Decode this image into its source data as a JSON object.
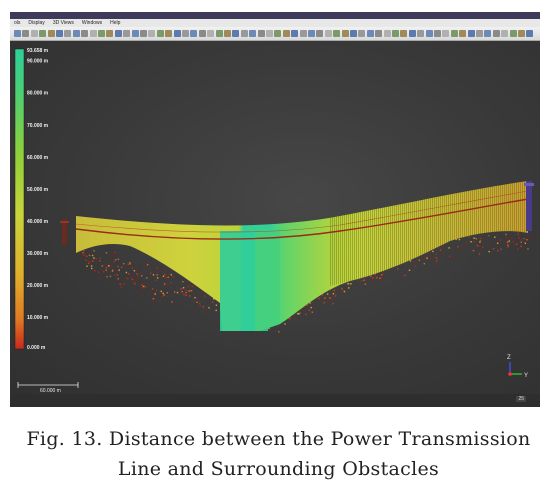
{
  "menubar": {
    "items": [
      "ols",
      "Display",
      "3D Views",
      "Windows",
      "Help"
    ]
  },
  "colorbar": {
    "labels": [
      "93.658 m",
      "90.000 m",
      "80.000 m",
      "70.000 m",
      "60.000 m",
      "50.000 m",
      "40.000 m",
      "30.000 m",
      "20.000 m",
      "10.000 m",
      "0.000 m"
    ],
    "values": [
      93.658,
      90,
      80,
      70,
      60,
      50,
      40,
      30,
      20,
      10,
      0
    ],
    "colors": {
      "top": "#2ecf9a",
      "mid": "#c6d63a",
      "low": "#e39a2a",
      "bottom": "#c8281e"
    }
  },
  "scale_bar": {
    "label": "60.000 m"
  },
  "axes": {
    "z": "Z",
    "y": "Y",
    "colors": {
      "z": "#3a5bff",
      "x": "#ff3030",
      "y": "#2fd42f"
    }
  },
  "statusbar": {
    "value": "25"
  },
  "caption": {
    "line1": "Fig. 13. Distance between the Power Transmission",
    "line2": "Line and Surrounding Obstacles"
  }
}
